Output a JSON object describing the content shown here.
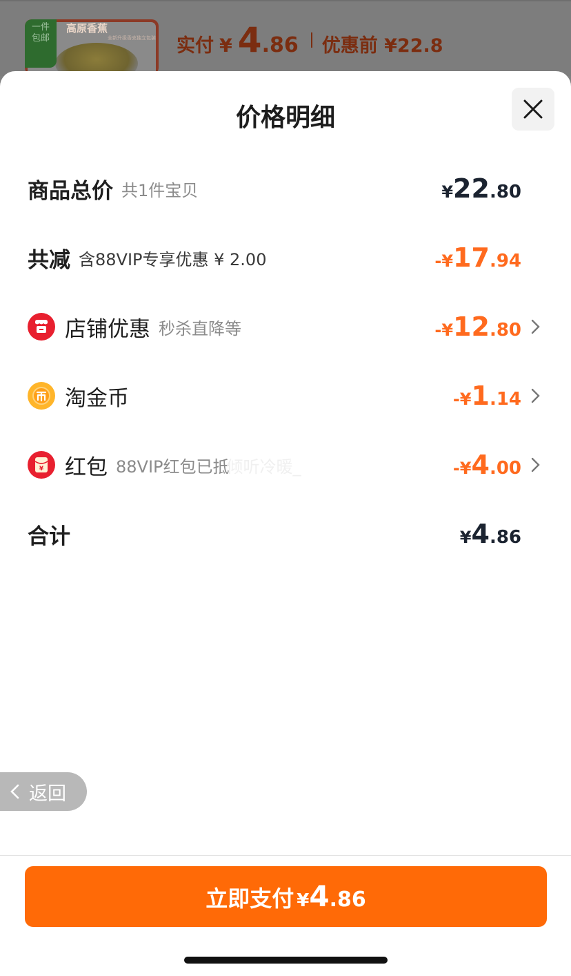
{
  "product": {
    "badge_line1": "一件",
    "badge_line2": "包邮",
    "title": "高原香蕉",
    "subtitle": "全新升级香支独立包装",
    "paid_label": "实付",
    "paid_currency": "¥",
    "paid_int": "4",
    "paid_dec": ".86",
    "orig_label": "优惠前 ¥22.8"
  },
  "sheet": {
    "title": "价格明细",
    "rows": [
      {
        "label": "商品总价",
        "note": "共1件宝贝",
        "currency": "¥",
        "int": "22",
        "dec": ".80"
      },
      {
        "label": "共减",
        "note": "含88VIP专享优惠 ¥ 2.00",
        "currency": "-¥",
        "int": "17",
        "dec": ".94"
      },
      {
        "label": "店铺优惠",
        "note": "秒杀直降等",
        "currency": "-¥",
        "int": "12",
        "dec": ".80",
        "icon": "shop-icon"
      },
      {
        "label": "淘金币",
        "note": "",
        "currency": "-¥",
        "int": "1",
        "dec": ".14",
        "icon": "coin-icon"
      },
      {
        "label": "红包",
        "note": "88VIP红包已抵",
        "currency": "-¥",
        "int": "4",
        "dec": ".00",
        "icon": "red-packet-icon"
      },
      {
        "label": "合计",
        "note": "",
        "currency": "¥",
        "int": "4",
        "dec": ".86"
      }
    ],
    "watermark": "倾听冷暖_",
    "back_label": "返回",
    "pay_button": {
      "label": "立即支付",
      "currency": "¥",
      "int": "4",
      "dec": ".86"
    }
  },
  "colors": {
    "accent": "#ff6a07",
    "discount": "#ff6a1e",
    "text": "#1f1f1f",
    "muted": "#8b8b8b"
  }
}
